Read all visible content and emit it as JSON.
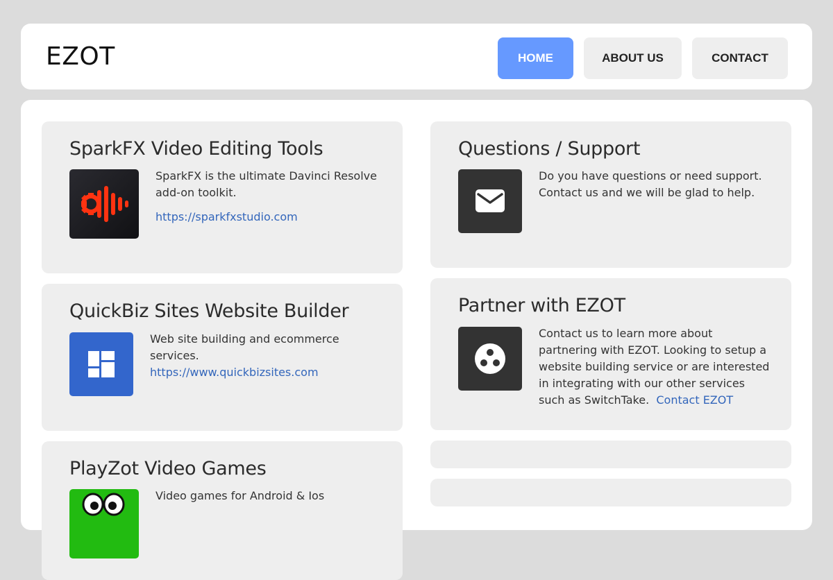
{
  "header": {
    "logo": "EZOT",
    "nav": [
      {
        "label": "HOME",
        "active": true
      },
      {
        "label": "ABOUT US",
        "active": false
      },
      {
        "label": "CONTACT",
        "active": false
      }
    ]
  },
  "cards": {
    "sparkfx": {
      "title": "SparkFX Video Editing Tools",
      "description": "SparkFX is the ultimate Davinci Resolve add-on toolkit.",
      "link": "https://sparkfxstudio.com",
      "icon": "sparkfx-logo-icon"
    },
    "quickbiz": {
      "title": "QuickBiz Sites Website Builder",
      "description": "Web site building and ecommerce services.",
      "link": "https://www.quickbizsites.com",
      "icon": "dashboard-layout-icon"
    },
    "playzot": {
      "title": "PlayZot Video Games",
      "description": "Video games for Android & Ios",
      "icon": "playzot-logo-icon"
    },
    "support": {
      "title": "Questions / Support",
      "description": "Do you have questions or need support. Contact us and we will be glad to help.",
      "icon": "envelope-icon"
    },
    "partner": {
      "title": "Partner with EZOT",
      "description": "Contact us to learn more about partnering with EZOT. Looking to setup a website building service or are interested in integrating with our other services such as SwitchTake.",
      "link": "Contact EZOT",
      "icon": "three-dots-circle-icon"
    }
  },
  "colors": {
    "background": "#dcdcdc",
    "panel": "#ffffff",
    "card": "#eeeeee",
    "nav_active": "#6699ff",
    "link": "#3366bb",
    "dark_icon": "#333333",
    "quickbiz_blue": "#3366cc",
    "sparkfx_red": "#ff3311",
    "playzot_green": "#22bb11"
  }
}
